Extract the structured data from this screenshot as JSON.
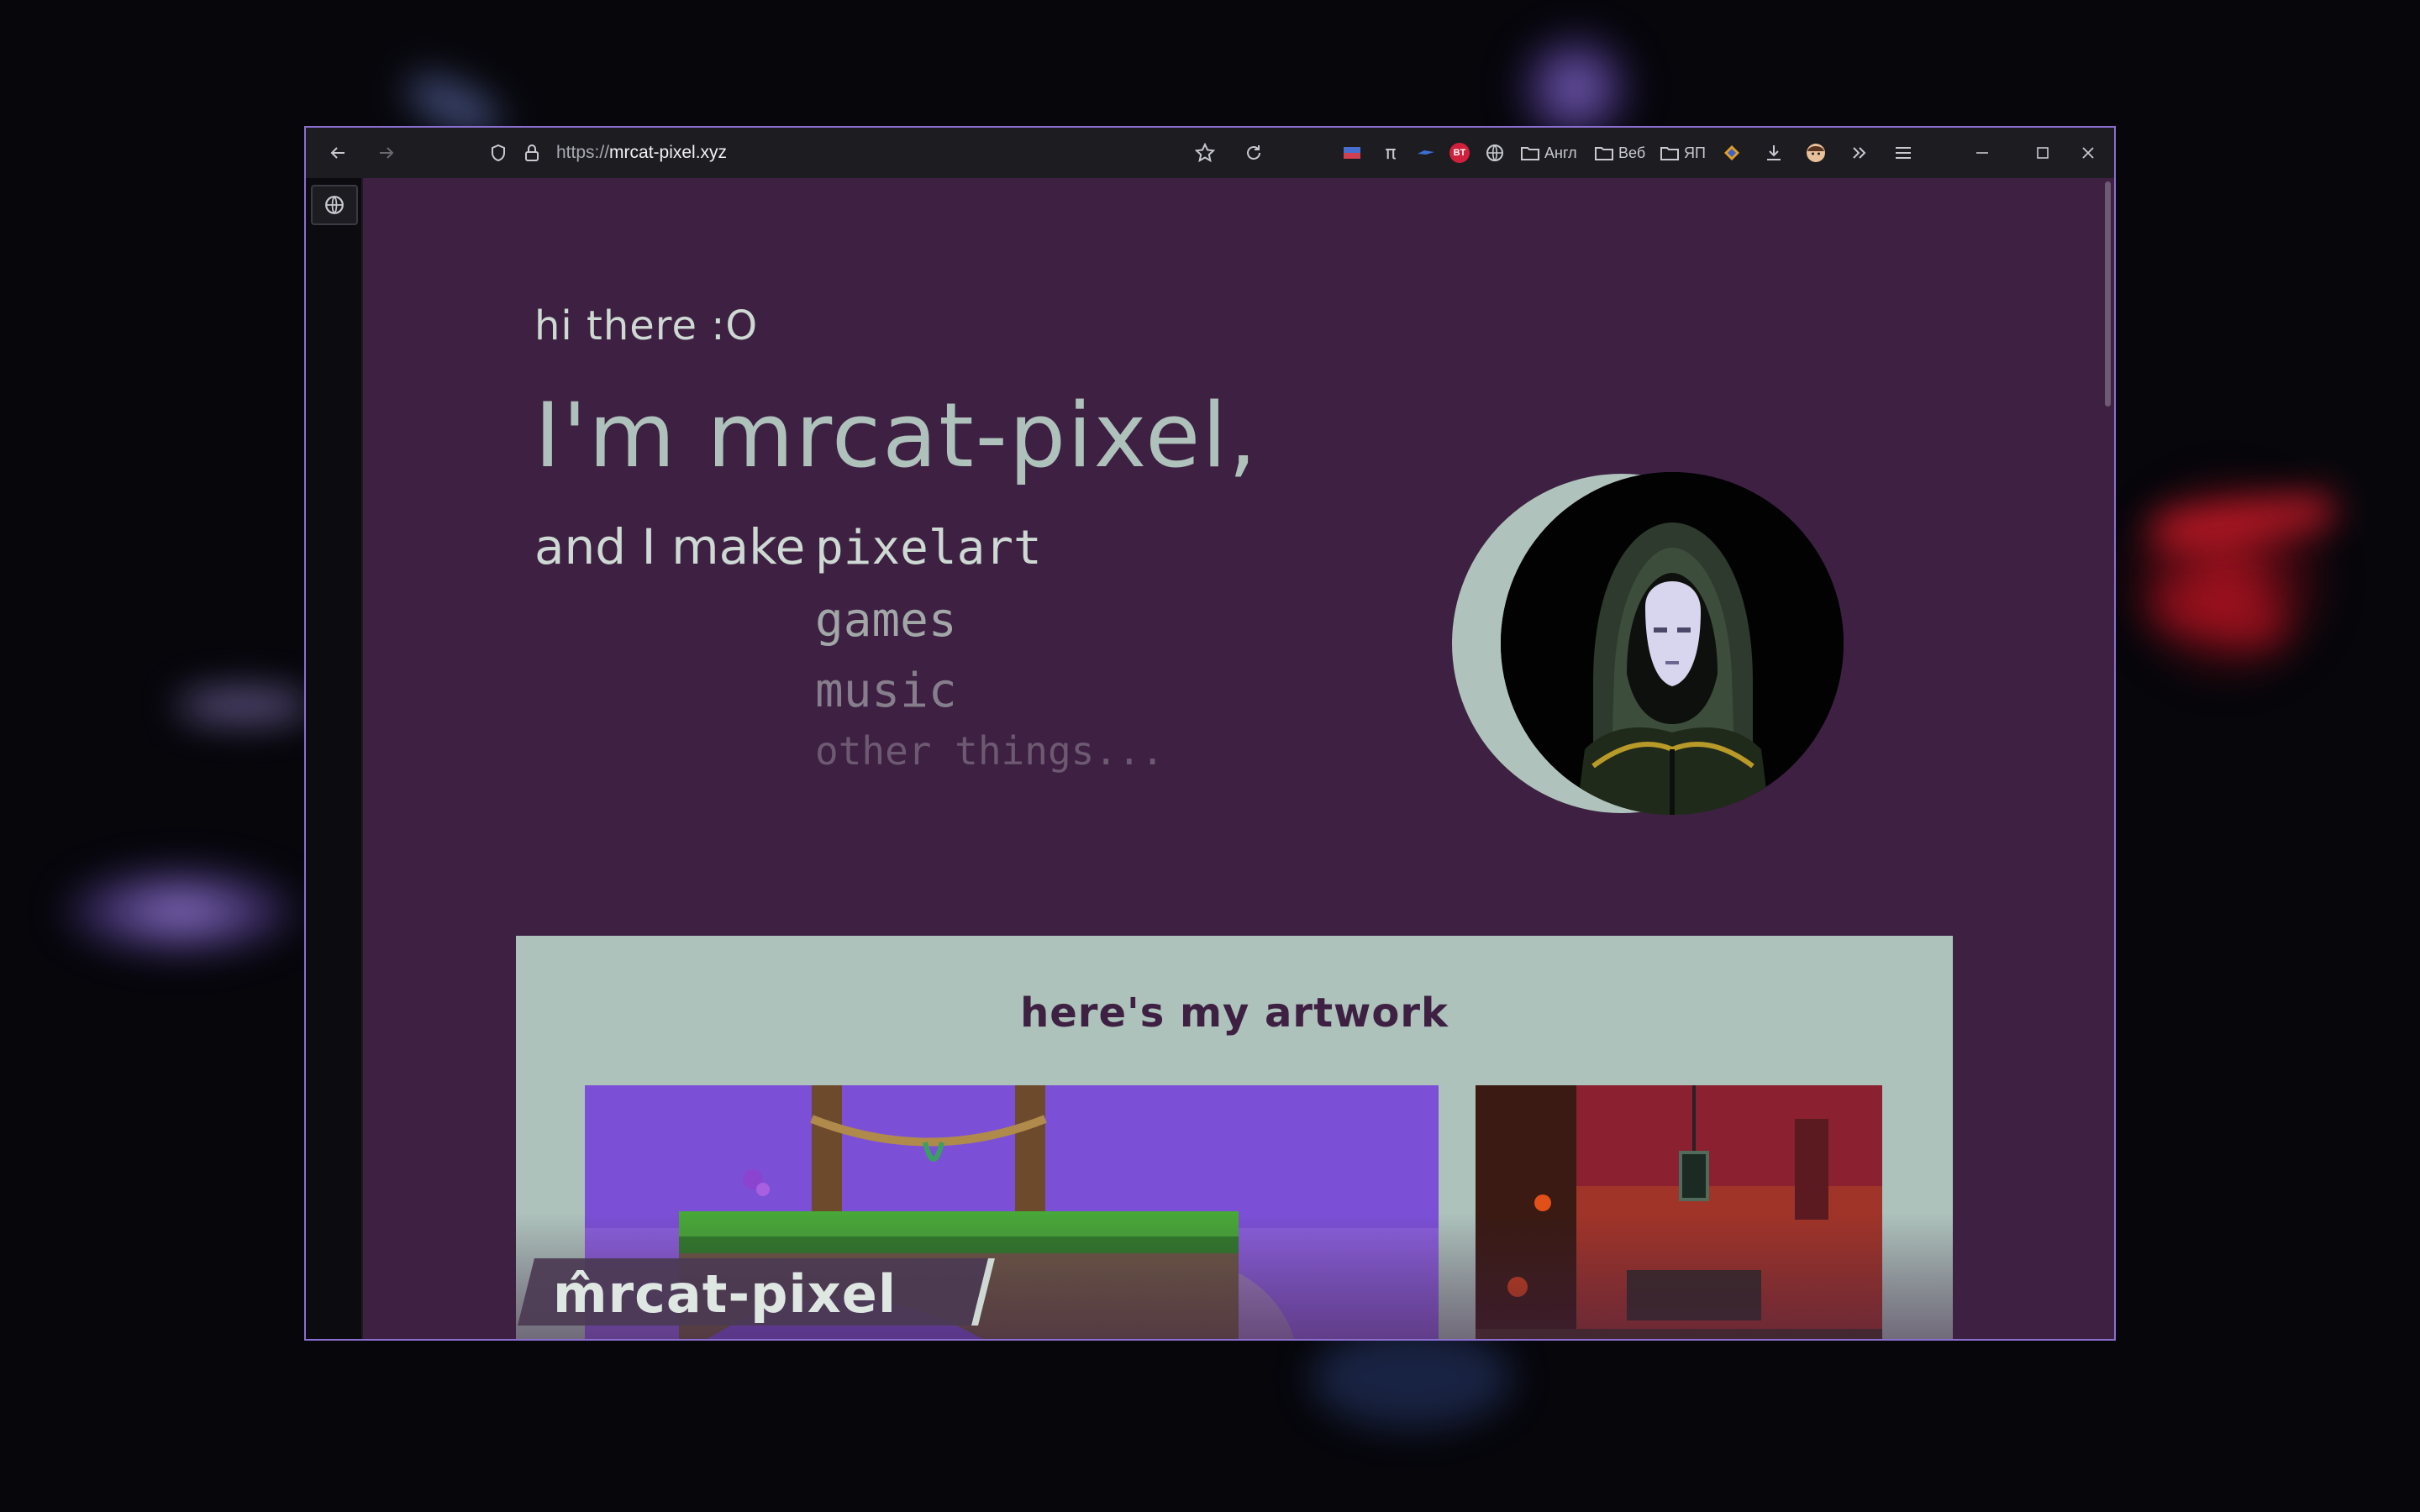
{
  "browser": {
    "url_prefix": "https://",
    "url_host": "mrcat-pixel.xyz",
    "pi_label": "π",
    "bt_badge": "BT",
    "bookmarks": [
      "Англ",
      "Веб",
      "ЯП"
    ]
  },
  "hero": {
    "greeting": "hi there :O",
    "headline": "I'm mrcat-pixel,",
    "make_label": "and I make",
    "make_items": [
      "pixelart",
      "games",
      "music",
      "other things..."
    ]
  },
  "artwork": {
    "title": "here's my artwork"
  },
  "logo": {
    "text": "m̂rcat-pixel"
  },
  "colors": {
    "page_background": "#3d2042",
    "accent_mint": "#aec2bb",
    "window_border": "#8b6fd0",
    "art1_sky": "#7b50d6"
  },
  "icons": [
    "back-arrow-icon",
    "forward-arrow-icon",
    "shield-icon",
    "lock-icon",
    "star-icon",
    "reload-icon",
    "globe-icon",
    "folder-icon",
    "download-icon",
    "overflow-chevrons-icon",
    "menu-icon",
    "minimize-icon",
    "maximize-icon",
    "close-icon"
  ]
}
